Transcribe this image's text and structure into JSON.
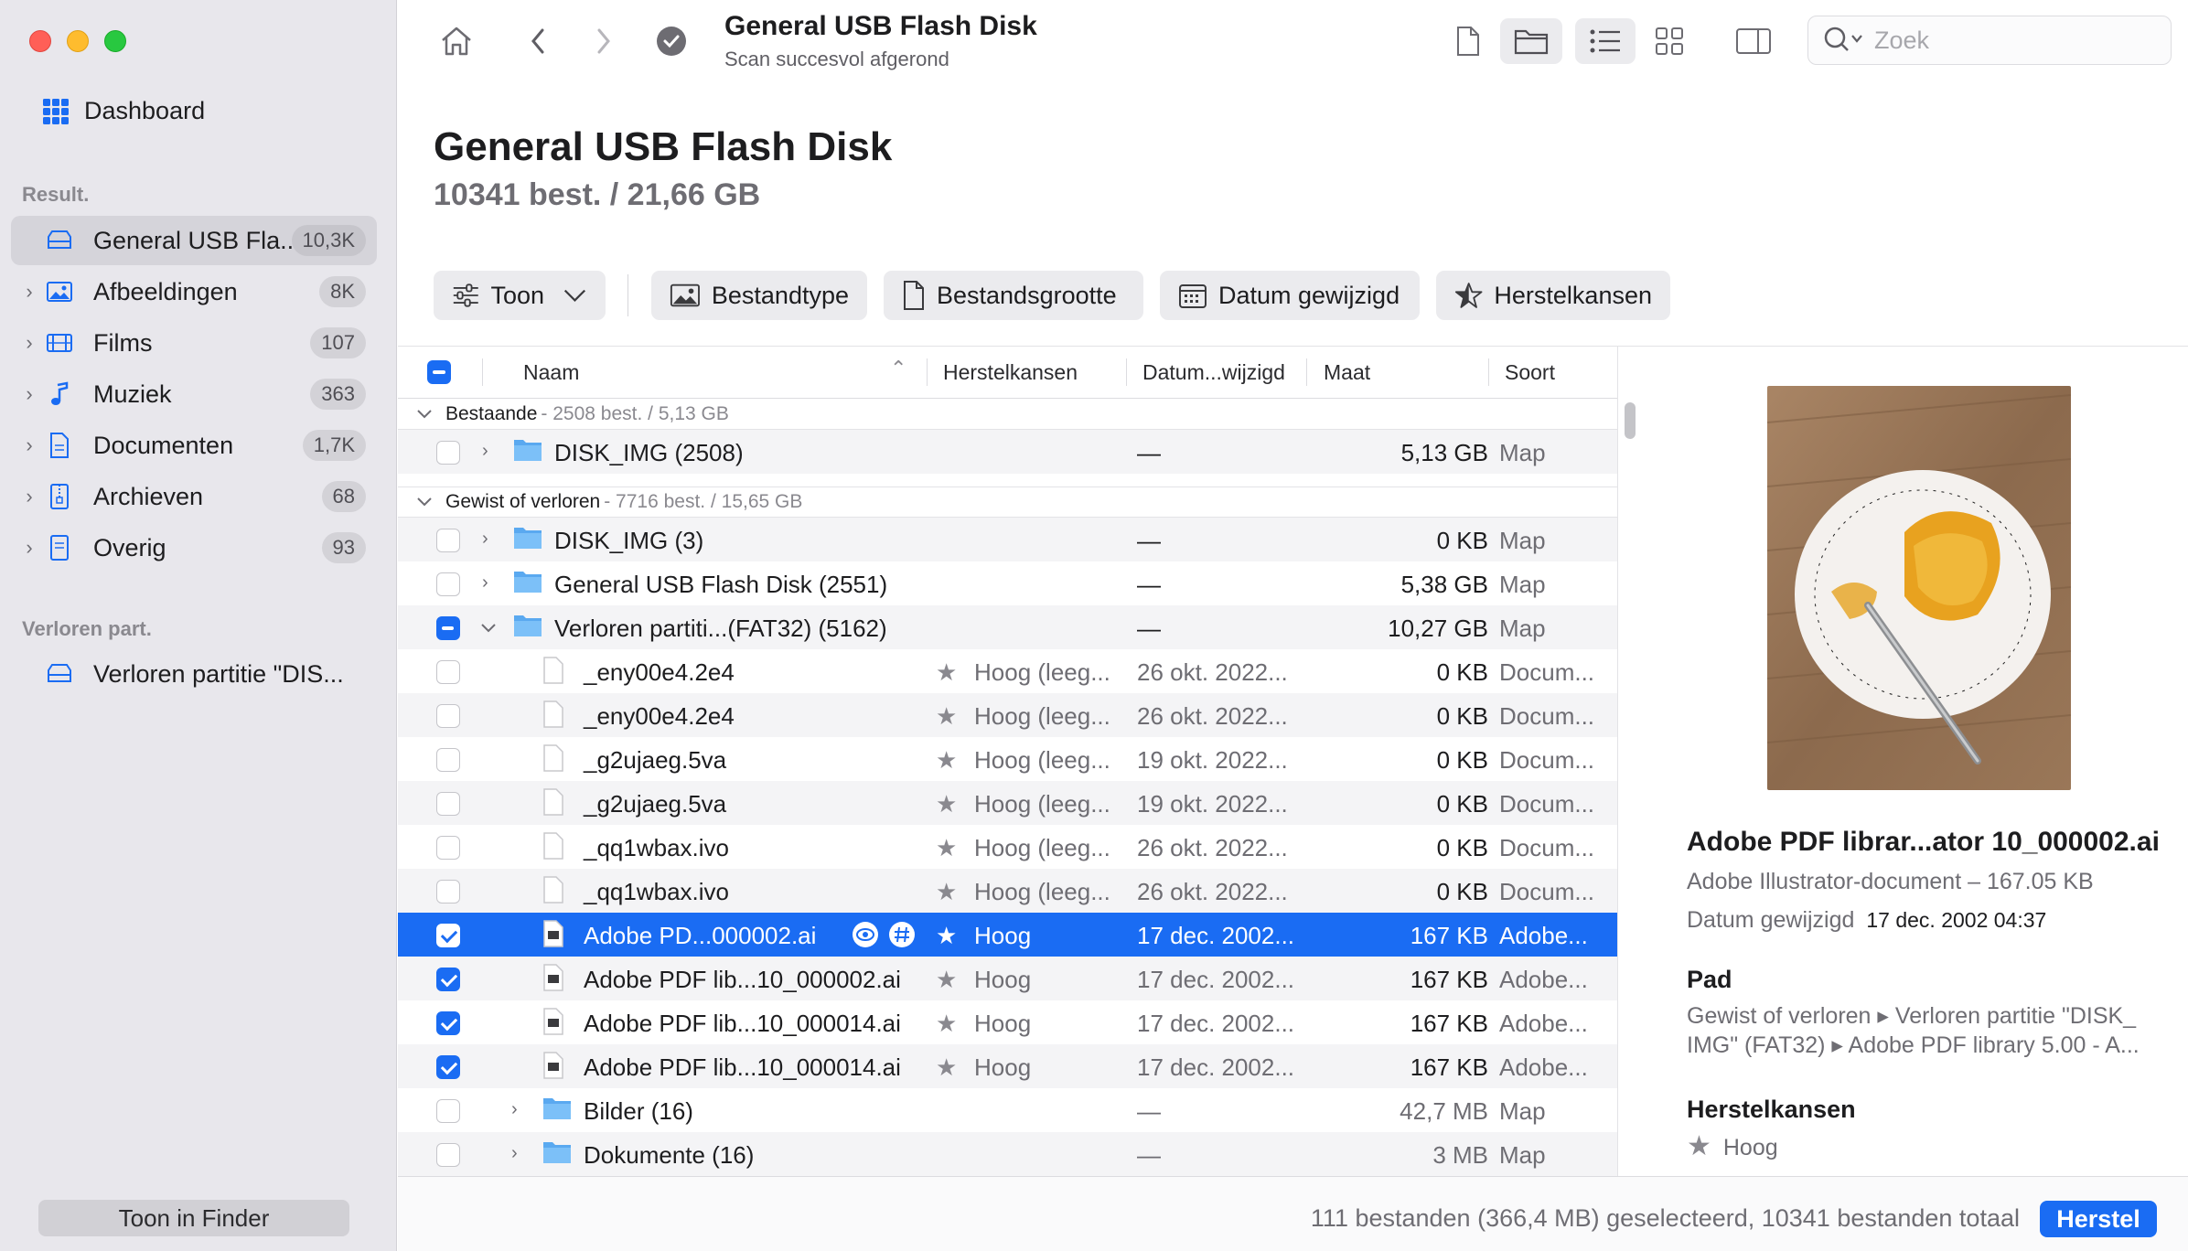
{
  "sidebar": {
    "dashboard": "Dashboard",
    "section_results": "Result.",
    "items": [
      {
        "label": "General USB Fla...",
        "badge": "10,3K",
        "icon": "drive-icon"
      },
      {
        "label": "Afbeeldingen",
        "badge": "8K",
        "icon": "image-icon"
      },
      {
        "label": "Films",
        "badge": "107",
        "icon": "film-icon"
      },
      {
        "label": "Muziek",
        "badge": "363",
        "icon": "music-icon"
      },
      {
        "label": "Documenten",
        "badge": "1,7K",
        "icon": "document-icon"
      },
      {
        "label": "Archieven",
        "badge": "68",
        "icon": "archive-icon"
      },
      {
        "label": "Overig",
        "badge": "93",
        "icon": "other-icon"
      }
    ],
    "section_lost": "Verloren part.",
    "lost_item": "Verloren partitie \"DIS...",
    "finder_button": "Toon in Finder"
  },
  "toolbar": {
    "title": "General USB Flash Disk",
    "subtitle": "Scan succesvol afgerond",
    "search_placeholder": "Zoek"
  },
  "header": {
    "title": "General USB Flash Disk",
    "subtitle": "10341 best. / 21,66 GB"
  },
  "filters": {
    "show": "Toon",
    "filetype": "Bestandtype",
    "filesize": "Bestandsgrootte",
    "date": "Datum gewijzigd",
    "chances": "Herstelkansen"
  },
  "table": {
    "columns": {
      "name": "Naam",
      "chances": "Herstelkansen",
      "date": "Datum...wijzigd",
      "size": "Maat",
      "kind": "Soort"
    },
    "group_existing": {
      "label": "Bestaande",
      "info": "- 2508 best. / 5,13 GB"
    },
    "group_lost": {
      "label": "Gewist of verloren",
      "info": "- 7716 best. / 15,65 GB"
    },
    "rows": [
      {
        "name": "DISK_IMG (2508)",
        "chances": "",
        "date": "—",
        "size": "5,13 GB",
        "kind": "Map"
      },
      {
        "name": "DISK_IMG (3)",
        "chances": "",
        "date": "—",
        "size": "0 KB",
        "kind": "Map"
      },
      {
        "name": "General USB Flash Disk (2551)",
        "chances": "",
        "date": "—",
        "size": "5,38 GB",
        "kind": "Map"
      },
      {
        "name": "Verloren partiti...(FAT32) (5162)",
        "chances": "",
        "date": "—",
        "size": "10,27 GB",
        "kind": "Map"
      },
      {
        "name": "_eny00e4.2e4",
        "chances": "Hoog (leeg...",
        "date": "26 okt. 2022...",
        "size": "0 KB",
        "kind": "Docum..."
      },
      {
        "name": "_eny00e4.2e4",
        "chances": "Hoog (leeg...",
        "date": "26 okt. 2022...",
        "size": "0 KB",
        "kind": "Docum..."
      },
      {
        "name": "_g2ujaeg.5va",
        "chances": "Hoog (leeg...",
        "date": "19 okt. 2022...",
        "size": "0 KB",
        "kind": "Docum..."
      },
      {
        "name": "_g2ujaeg.5va",
        "chances": "Hoog (leeg...",
        "date": "19 okt. 2022...",
        "size": "0 KB",
        "kind": "Docum..."
      },
      {
        "name": "_qq1wbax.ivo",
        "chances": "Hoog (leeg...",
        "date": "26 okt. 2022...",
        "size": "0 KB",
        "kind": "Docum..."
      },
      {
        "name": "_qq1wbax.ivo",
        "chances": "Hoog (leeg...",
        "date": "26 okt. 2022...",
        "size": "0 KB",
        "kind": "Docum..."
      },
      {
        "name": "Adobe PD...000002.ai",
        "chances": "Hoog",
        "date": "17 dec. 2002...",
        "size": "167 KB",
        "kind": "Adobe..."
      },
      {
        "name": "Adobe PDF lib...10_000002.ai",
        "chances": "Hoog",
        "date": "17 dec. 2002...",
        "size": "167 KB",
        "kind": "Adobe..."
      },
      {
        "name": "Adobe PDF lib...10_000014.ai",
        "chances": "Hoog",
        "date": "17 dec. 2002...",
        "size": "167 KB",
        "kind": "Adobe..."
      },
      {
        "name": "Adobe PDF lib...10_000014.ai",
        "chances": "Hoog",
        "date": "17 dec. 2002...",
        "size": "167 KB",
        "kind": "Adobe..."
      },
      {
        "name": "Bilder (16)",
        "chances": "",
        "date": "—",
        "size": "42,7 MB",
        "kind": "Map"
      },
      {
        "name": "Dokumente (16)",
        "chances": "",
        "date": "—",
        "size": "3 MB",
        "kind": "Map"
      }
    ]
  },
  "preview": {
    "name": "Adobe PDF librar...ator 10_000002.ai",
    "kind": "Adobe Illustrator-document – 167.05 KB",
    "date_label": "Datum gewijzigd",
    "date_value": "17 dec. 2002 04:37",
    "path_heading": "Pad",
    "path_line1": "Gewist of verloren ▸ Verloren partitie \"DISK_",
    "path_line2": "IMG\" (FAT32) ▸ Adobe PDF library 5.00 - A...",
    "chances_heading": "Herstelkansen",
    "chances_value": "Hoog"
  },
  "footer": {
    "status": "111 bestanden (366,4 MB) geselecteerd, 10341 bestanden totaal",
    "recover_button": "Herstel"
  },
  "colors": {
    "accent": "#1a6cf3",
    "sidebar_bg": "#e8e7ec"
  }
}
